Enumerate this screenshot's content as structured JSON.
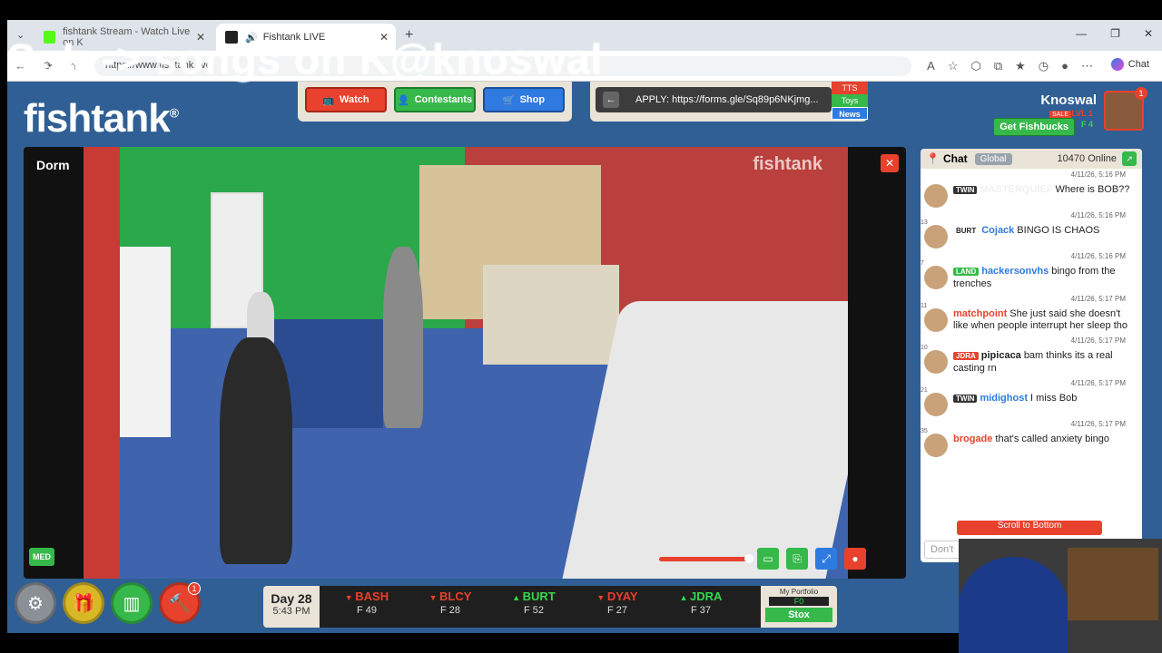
{
  "browser": {
    "tabs": [
      {
        "title": "fishtank Stream - Watch Live on K"
      },
      {
        "title": "Fishtank LIVE"
      }
    ],
    "url": "https://www.fishtank.live",
    "chat_button": "Chat"
  },
  "overlay": "Sub -> songs on K@knoswal",
  "site": {
    "logo": "fishtank",
    "logo_mark": "®",
    "nav": {
      "watch": "Watch",
      "contestants": "Contestants",
      "shop": "Shop"
    },
    "news": {
      "text": "APPLY: https://forms.gle/Sq89p6NKjmg...",
      "tabs": [
        "TTS",
        "Toys",
        "News"
      ]
    },
    "user": {
      "name": "Knoswal",
      "level": "LVL 1",
      "balance": "F 4",
      "sale": "SALE",
      "get_fishbucks": "Get Fishbucks",
      "notifications": "1"
    }
  },
  "stage": {
    "room": "Dorm",
    "watermark": "fishtank",
    "quality": "MED",
    "volume": 0.9
  },
  "bottom": {
    "shop_badge": "1",
    "day": "Day 28",
    "time": "5:43 PM",
    "stocks": [
      {
        "sym": "BASH",
        "price": "F 49",
        "dir": "down"
      },
      {
        "sym": "BLCY",
        "price": "F 28",
        "dir": "down"
      },
      {
        "sym": "BURT",
        "price": "F 52",
        "dir": "up"
      },
      {
        "sym": "DYAY",
        "price": "F 27",
        "dir": "down"
      },
      {
        "sym": "JDRA",
        "price": "F 37",
        "dir": "up"
      }
    ],
    "portfolio_label": "My Portfolio",
    "portfolio_value": "F0",
    "stox": "Stox"
  },
  "chat": {
    "title": "Chat",
    "scope": "Global",
    "online": "10470 Online",
    "messages": [
      {
        "ts_before": "4/11/26, 5:16 PM",
        "lvl": "",
        "tag": "TWIN",
        "user": "MASTERQUIEF",
        "text": "Where is BOB??"
      },
      {
        "ts_before": "4/11/26, 5:16 PM",
        "lvl": "13",
        "tag": "BURT",
        "user": "Cojack",
        "text": "BINGO IS CHAOS"
      },
      {
        "ts_before": "4/11/26, 5:16 PM",
        "lvl": "7",
        "tag": "LAND",
        "user": "hackersonvhs",
        "text": "bingo from the trenches"
      },
      {
        "ts_before": "4/11/26, 5:17 PM",
        "lvl": "11",
        "tag": "",
        "user": "matchpoint",
        "text": "She just said she doesn't like when people interrupt her sleep tho"
      },
      {
        "ts_before": "4/11/26, 5:17 PM",
        "lvl": "10",
        "tag": "JDRA",
        "user": "pipicaca",
        "text": "bam thinks its a real casting rn"
      },
      {
        "ts_before": "4/11/26, 5:17 PM",
        "lvl": "21",
        "tag": "TWIN",
        "user": "midighost",
        "text": "I miss Bob"
      },
      {
        "ts_before": "4/11/26, 5:17 PM",
        "lvl": "35",
        "tag": "",
        "user": "brogade",
        "text": "that's called anxiety bingo"
      }
    ],
    "scroll_to_bottom": "Scroll to Bottom",
    "input_placeholder": "Don't"
  }
}
